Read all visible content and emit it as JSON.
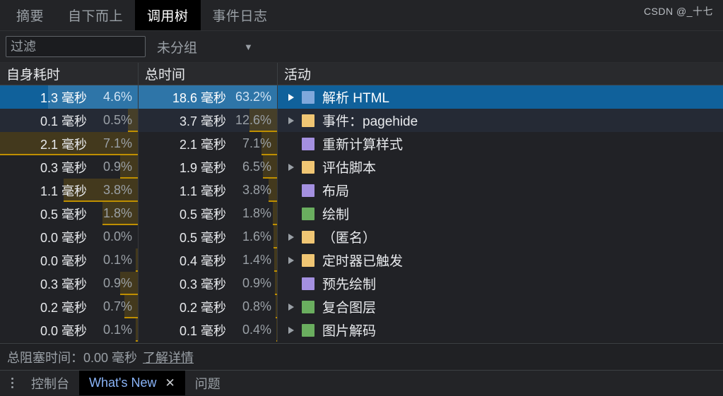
{
  "tabs": [
    {
      "label": "摘要",
      "active": false
    },
    {
      "label": "自下而上",
      "active": false
    },
    {
      "label": "调用树",
      "active": true
    },
    {
      "label": "事件日志",
      "active": false
    }
  ],
  "toolbar": {
    "filter_value": "",
    "filter_placeholder": "过滤",
    "grouping_label": "未分组",
    "caret_icon": "▼"
  },
  "table": {
    "columns": [
      {
        "key": "self",
        "label": "自身耗时"
      },
      {
        "key": "total",
        "label": "总时间"
      },
      {
        "key": "activity",
        "label": "活动"
      }
    ],
    "rows": [
      {
        "self_time": "1.3 毫秒",
        "self_pct": "4.6%",
        "self_pct_value": 4.6,
        "total_time": "18.6 毫秒",
        "total_pct": "63.2%",
        "total_pct_value": 63.2,
        "activity": "解析 HTML",
        "color": "#7FA8DC",
        "expandable": true,
        "selected": true,
        "alt": false
      },
      {
        "self_time": "0.1 毫秒",
        "self_pct": "0.5%",
        "self_pct_value": 0.5,
        "total_time": "3.7 毫秒",
        "total_pct": "12.6%",
        "total_pct_value": 12.6,
        "activity": "事件：pagehide",
        "color": "#F0C674",
        "expandable": true,
        "selected": false,
        "alt": true
      },
      {
        "self_time": "2.1 毫秒",
        "self_pct": "7.1%",
        "self_pct_value": 7.1,
        "total_time": "2.1 毫秒",
        "total_pct": "7.1%",
        "total_pct_value": 7.1,
        "activity": "重新计算样式",
        "color": "#A490E0",
        "expandable": false,
        "selected": false,
        "alt": false
      },
      {
        "self_time": "0.3 毫秒",
        "self_pct": "0.9%",
        "self_pct_value": 0.9,
        "total_time": "1.9 毫秒",
        "total_pct": "6.5%",
        "total_pct_value": 6.5,
        "activity": "评估脚本",
        "color": "#F0C674",
        "expandable": true,
        "selected": false,
        "alt": false
      },
      {
        "self_time": "1.1 毫秒",
        "self_pct": "3.8%",
        "self_pct_value": 3.8,
        "total_time": "1.1 毫秒",
        "total_pct": "3.8%",
        "total_pct_value": 3.8,
        "activity": "布局",
        "color": "#A490E0",
        "expandable": false,
        "selected": false,
        "alt": false
      },
      {
        "self_time": "0.5 毫秒",
        "self_pct": "1.8%",
        "self_pct_value": 1.8,
        "total_time": "0.5 毫秒",
        "total_pct": "1.8%",
        "total_pct_value": 1.8,
        "activity": "绘制",
        "color": "#6AAE5F",
        "expandable": false,
        "selected": false,
        "alt": false
      },
      {
        "self_time": "0.0 毫秒",
        "self_pct": "0.0%",
        "self_pct_value": 0.0,
        "total_time": "0.5 毫秒",
        "total_pct": "1.6%",
        "total_pct_value": 1.6,
        "activity": "（匿名）",
        "color": "#F0C674",
        "expandable": true,
        "selected": false,
        "alt": false
      },
      {
        "self_time": "0.0 毫秒",
        "self_pct": "0.1%",
        "self_pct_value": 0.1,
        "total_time": "0.4 毫秒",
        "total_pct": "1.4%",
        "total_pct_value": 1.4,
        "activity": "定时器已触发",
        "color": "#F0C674",
        "expandable": true,
        "selected": false,
        "alt": false
      },
      {
        "self_time": "0.3 毫秒",
        "self_pct": "0.9%",
        "self_pct_value": 0.9,
        "total_time": "0.3 毫秒",
        "total_pct": "0.9%",
        "total_pct_value": 0.9,
        "activity": "预先绘制",
        "color": "#A490E0",
        "expandable": false,
        "selected": false,
        "alt": false
      },
      {
        "self_time": "0.2 毫秒",
        "self_pct": "0.7%",
        "self_pct_value": 0.7,
        "total_time": "0.2 毫秒",
        "total_pct": "0.8%",
        "total_pct_value": 0.8,
        "activity": "复合图层",
        "color": "#6AAE5F",
        "expandable": true,
        "selected": false,
        "alt": false
      },
      {
        "self_time": "0.0 毫秒",
        "self_pct": "0.1%",
        "self_pct_value": 0.1,
        "total_time": "0.1 毫秒",
        "total_pct": "0.4%",
        "total_pct_value": 0.4,
        "activity": "图片解码",
        "color": "#6AAE5F",
        "expandable": true,
        "selected": false,
        "alt": false
      }
    ],
    "self_bar_max_pct": 7.1,
    "total_bar_max_pct": 63.2
  },
  "status": {
    "label": "总阻塞时间：0.00 毫秒",
    "link": "了解详情"
  },
  "drawer": {
    "menu_icon": "more-vertical",
    "tabs": [
      {
        "label": "控制台",
        "active": false,
        "closable": false
      },
      {
        "label": "What's New",
        "active": true,
        "closable": true,
        "close_icon": "✕"
      },
      {
        "label": "问题",
        "active": false,
        "closable": false
      }
    ]
  },
  "watermark": "CSDN @_十七"
}
